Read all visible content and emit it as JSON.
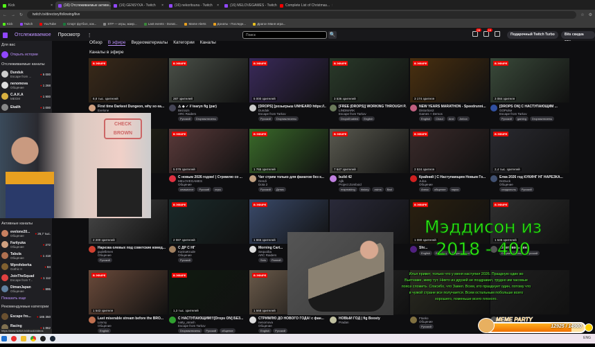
{
  "browser": {
    "tabs": [
      {
        "label": "Kick",
        "color": "#53fc18"
      },
      {
        "label": "(16) Отслеживаемые активн...",
        "color": "#9147ff",
        "active": true
      },
      {
        "label": "(16) GENSYXA - Twitch",
        "color": "#9147ff"
      },
      {
        "label": "(16) nekoritsuna - Twitch",
        "color": "#9147ff"
      },
      {
        "label": "(16) MELOVEGAMES - Twitch",
        "color": "#9147ff"
      },
      {
        "label": "Complete List of Christmas...",
        "color": "#ff0000"
      }
    ],
    "url": "twitch.tv/directory/following/live",
    "bookmarks": [
      {
        "label": "Kick",
        "color": "#53fc18"
      },
      {
        "label": "Twitch",
        "color": "#9147ff"
      },
      {
        "label": "YouTube",
        "color": "#ff0000"
      },
      {
        "label": "Спорт футбол, хок...",
        "color": "#1a7a3a"
      },
      {
        "label": "STP — игры, жанр...",
        "color": "#888"
      },
      {
        "label": "Last events - Donat...",
        "color": "#3a8a3a"
      },
      {
        "label": "Mame Alerts",
        "color": "#e8a020"
      },
      {
        "label": "Донаты - Последн...",
        "color": "#e8a020"
      },
      {
        "label": "Драгон Маня игра...",
        "color": "#e8c020"
      }
    ]
  },
  "topnav": {
    "following": "Отслеживаемое",
    "browse": "Просмотр",
    "more": "⋮",
    "search_placeholder": "Поиск",
    "search_icon": "🔍",
    "badge1": "28",
    "badge2": "16",
    "turbo": "Подарочный Twitch Turbo",
    "bits": "Bits скидка 20%"
  },
  "sidebar": {
    "for_you": "Для вас",
    "stories": "Открыть истории",
    "followed_header": "Отслеживаемые каналы",
    "followed": [
      {
        "name": "Dunduk",
        "sub": "Escape from ...",
        "count": "5 000",
        "color": "#ccc"
      },
      {
        "name": "nenomova",
        "sub": "Общение",
        "count": "1 268",
        "color": "#ddd"
      },
      {
        "name": "C.A.K.A",
        "sub": "MEGM",
        "count": "1 900",
        "color": "#d8b040"
      },
      {
        "name": "Ekalih",
        "sub": "",
        "count": "1 000",
        "color": "#888"
      }
    ],
    "live_header": "Активные каналы",
    "live": [
      {
        "name": "evelone20...",
        "sub": "Общение",
        "count": "26,7 тыс.",
        "color": "#c88060"
      },
      {
        "name": "Fariiyuka",
        "sub": "Общение",
        "count": "272",
        "color": "#d0a080"
      },
      {
        "name": "Tabula",
        "sub": "Общение",
        "count": "1 418",
        "color": "#b07050"
      },
      {
        "name": "Wprofeberka",
        "sub": "Gothic II",
        "count": "84",
        "color": "#806030"
      },
      {
        "name": "JoinTheSquad",
        "sub": "Escape from T...",
        "count": "1 112",
        "color": "#e04040"
      },
      {
        "name": "DimanJapan",
        "sub": "Общение",
        "count": "895",
        "color": "#6080a0"
      }
    ],
    "show_more": "Показать еще",
    "cat_header": "Рекомендуемые категории",
    "cats": [
      {
        "name": "Escape fro...",
        "sub": "",
        "count": "185 350",
        "color": "#6a5030"
      },
      {
        "name": "Racing",
        "sub": "Вождение и гон...",
        "count": "1 862",
        "color": "#807050"
      }
    ],
    "status_url": "https://www.twitch.tv/dbuck/videos"
  },
  "main": {
    "subtabs": [
      "Обзор",
      "В эфире",
      "Видеоматериалы",
      "Категории",
      "Каналы"
    ],
    "active_tab": 1,
    "heading": "Каналы в эфире",
    "live_label": "В ЭФИРЕ",
    "cards": [
      {
        "title": "First time Darkest Dungeon, why so ea...",
        "channel": "Evelone",
        "category": "",
        "viewers": "8,8 тыс. зрителей",
        "tags": [],
        "color": "#3a2a1a",
        "avatar": "#d0a080"
      },
      {
        "title": "⚠ ◆ ✓ // tearyn fig (par)",
        "channel": "Bezrazn",
        "category": "ARC Raiders",
        "viewers": "287 зрителей",
        "tags": [
          "Русский",
          "Dropsвключены"
        ],
        "color": "#4a5048",
        "avatar": "#445"
      },
      {
        "title": "[DROPS] [розыгрыш UNHEARD https://...",
        "channel": "Dunduk",
        "category": "Escape from Tarkov",
        "viewers": "5 000 зрителей",
        "tags": [
          "Русский",
          "Dropsвключены"
        ],
        "color": "#3a2a5a",
        "avatar": "#ccc"
      },
      {
        "title": "[FREE (DROPS)] WORKING THROUGH P...",
        "channel": "LINDMARK",
        "category": "Escape from Tarkov",
        "viewers": "3 536 зрителей",
        "tags": [
          "DropsEnabled",
          "English"
        ],
        "color": "#2a3a2a",
        "avatar": "#6a7a5a"
      },
      {
        "title": "NEW YEARS MARATHON - Speedrunni...",
        "channel": "Distortion2",
        "category": "Games + Demos",
        "viewers": "3 174 зрителя",
        "tags": [
          "English",
          "Chaul",
          "Anxi",
          "Anbox"
        ],
        "color": "#4a3010",
        "avatar": "#c06080"
      },
      {
        "title": "[DROPS ON] С НАСТУПАЮЩИМ ...",
        "channel": "GOPulse",
        "category": "Escape from Tarkov",
        "viewers": "3 084 зрителя",
        "tags": [
          "Русский",
          "gaming",
          "Dropsвключены"
        ],
        "color": "#3a4a3a",
        "avatar": "#3050a0"
      },
      {
        "title": "...соле В...",
        "channel": "",
        "category": "",
        "viewers": "",
        "tags": [],
        "color": "#2a2a1a",
        "avatar": "#555"
      },
      {
        "title": "С новым 2026 годом! | Стримлю со ...",
        "channel": "MELOVEGAMES",
        "category": "Общение",
        "viewers": "5 079 зрителей",
        "tags": [
          "семьиспот",
          "Русский",
          "игры"
        ],
        "color": "#5a3a3a",
        "avatar": "#e03040"
      },
      {
        "title": "Чат стрим только для фанатов без к...",
        "channel": "Dendi",
        "category": "Dota 2",
        "viewers": "1 765 зрителей",
        "tags": [
          "Русский",
          "Денис"
        ],
        "color": "#3a6a2a",
        "avatar": "#c0a080"
      },
      {
        "title": "build 42",
        "channel": "Ajlk",
        "category": "Project Zomboid",
        "viewers": "7 647 зрителей",
        "tags": [
          "mapmaking",
          "history",
          "zsims",
          "Bad"
        ],
        "color": "#5a5a50",
        "avatar": "#c080e0"
      },
      {
        "title": "Крайний | С Наступающим Новым Го...",
        "channel": "Julca",
        "category": "Общение",
        "viewers": "2 524 зрителя",
        "tags": [
          "Анекс",
          "общение",
          "нарко"
        ],
        "color": "#3a2a2a",
        "avatar": "#d02020"
      },
      {
        "title": "Елка 2026 год КУКИНГ НГ НАРЕЗКА...",
        "channel": "DeDuck",
        "category": "Общение",
        "viewers": "2,4 тыс. зрителей",
        "tags": [
          "сладкоголь",
          "Русский"
        ],
        "color": "#2a2a30",
        "avatar": "#405070"
      },
      {
        "title": "Нарезка олевых под советские комед...",
        "channel": "gudelbmen",
        "category": "Общение",
        "viewers": "2 200 зрителей",
        "tags": [
          "Русский"
        ],
        "color": "#4a4a4a",
        "avatar": "#d04030"
      },
      {
        "title": "С ДР С НГ",
        "channel": "KarinaKrude",
        "category": "Общение",
        "viewers": "2 087 зрителей",
        "tags": [
          "Русский"
        ],
        "color": "#1a2a2a",
        "avatar": "#a08060"
      },
      {
        "title": "Morning Cart...",
        "channel": "Sequoiba",
        "category": "ARC Raiders",
        "viewers": "1 865 зрителей",
        "tags": [
          "Solo",
          "Ранний"
        ],
        "color": "#3a4a6a",
        "avatar": "#ddd"
      },
      {
        "title": "",
        "channel": "",
        "category": "",
        "viewers": "",
        "tags": [],
        "color": "#2a2a3a",
        "avatar": "#555"
      },
      {
        "title": "Shr...",
        "channel": "",
        "category": "",
        "viewers": "1 080 зрителей",
        "tags": [
          "English",
          "Bleeding",
          "Dropsenabled"
        ],
        "color": "#2a2010",
        "avatar": "#502080"
      },
      {
        "title": "...iders весь день",
        "channel": "",
        "category": "",
        "viewers": "1 645 зрителей",
        "tags": [
          "Dropsвключены",
          "Русский"
        ],
        "color": "#303030",
        "avatar": "#555"
      },
      {
        "title": "Last miserable stream before the BRO...",
        "channel": "Limmy",
        "category": "Общение",
        "viewers": "1 543 зрителя",
        "tags": [
          "English"
        ],
        "color": "#6a4a3a",
        "avatar": "#c07050"
      },
      {
        "title": "С НАСТУПАЮЩИМ!!![Drops ON] БЕЗ...",
        "channel": "natty_atrash",
        "category": "Escape from Tarkov",
        "viewers": "1,3 тыс. зрителей",
        "tags": [
          "Dropsвключены",
          "Русский",
          "общение"
        ],
        "color": "#101a10",
        "avatar": "#30a030"
      },
      {
        "title": "СТРИМЛЮ ДО НОВОГО ГОДА! с фан...",
        "channel": "nenomova",
        "category": "Общение",
        "viewers": "1 568 зрителей",
        "tags": [
          "English",
          "Русский"
        ],
        "color": "#6a5a4a",
        "avatar": "#ddd"
      },
      {
        "title": "НОВЫЙ ГОД | fig Boosty",
        "channel": "Pradan",
        "category": "",
        "viewers": "",
        "tags": [],
        "color": "#2a2a2a",
        "avatar": "#c0c0a0"
      },
      {
        "title": "",
        "channel": "Ftasko",
        "category": "Общение",
        "viewers": "",
        "tags": [
          "Русский"
        ],
        "color": "#2a2a20",
        "avatar": "#807040"
      },
      {
        "title": "",
        "channel": "",
        "category": "",
        "viewers": "",
        "tags": [],
        "color": "#202020",
        "avatar": "#555"
      }
    ]
  },
  "overlays": {
    "webcam_sign": "CHECK BROWN",
    "big_text_1": "Мэддисон из",
    "big_text_2": "2018 - 400",
    "message": "Илья привет, только что у меня наступил 2026. Праздную один во Вьетнаме, живу тут. Никто из друзей не поздравил, трудно им часовые пояса сложить. Спасибо, что Завел. Всем, кто празднует один, потому что в чужой стране все получается. Всем остальным побольше всего хорошего, поменьше всего плохого.",
    "meme_title": "MEME PARTY",
    "meme_progress": "12925 / 14900",
    "meme_fraction": 0.867
  },
  "taskbar": {
    "lang": "ENG"
  }
}
